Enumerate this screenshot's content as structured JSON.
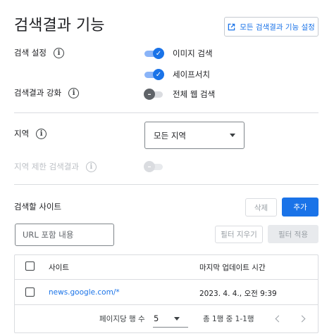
{
  "header": {
    "title": "검색결과 기능",
    "all_settings_button": "모든 검색결과 기능 설정"
  },
  "search_settings": {
    "label": "검색 설정",
    "image_search": "이미지 검색",
    "safe_search": "세이프서치"
  },
  "search_enhance": {
    "label": "검색결과 강화",
    "web_search": "전체 웹 검색"
  },
  "region": {
    "label": "지역",
    "selected": "모든 지역",
    "restrict_label": "지역 제한 검색결과"
  },
  "sites": {
    "label": "검색할 사이트",
    "delete_button": "삭제",
    "add_button": "추가",
    "url_placeholder": "URL 포함 내용",
    "clear_filter_button": "필터 지우기",
    "apply_filter_button": "필터 적용",
    "columns": [
      "사이트",
      "마지막 업데이트 시간"
    ],
    "rows": [
      {
        "site": "news.google.com/*",
        "updated": "2023. 4. 4., 오전 9:39"
      }
    ],
    "pagination": {
      "rows_per_page_label": "페이지당 행 수",
      "rows_per_page": "5",
      "range": "총 1행 중 1-1행"
    }
  },
  "colors": {
    "accent": "#1a73e8",
    "divider": "#dadce0"
  },
  "icons": [
    "open-in-new-icon",
    "info-icon",
    "check-icon",
    "minus-icon",
    "caret-down-icon",
    "chevron-left-icon",
    "chevron-right-icon"
  ]
}
